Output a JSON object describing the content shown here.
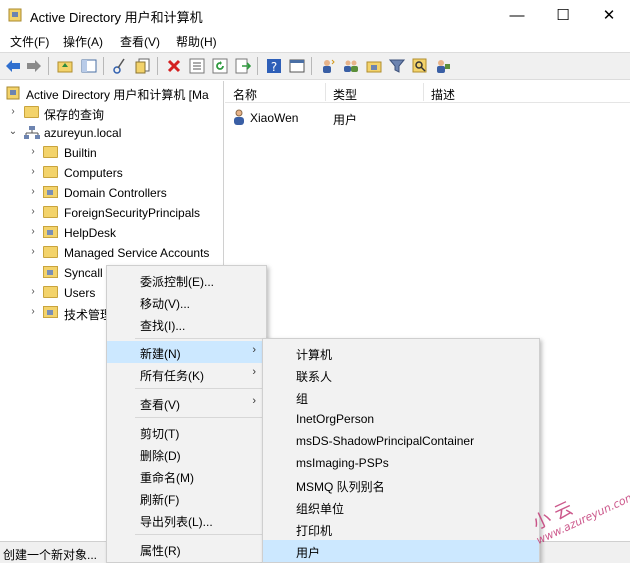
{
  "window": {
    "title": "Active Directory 用户和计算机",
    "minimize_glyph": "—",
    "maximize_glyph": "☐",
    "close_glyph": "✕"
  },
  "menubar": [
    "文件(F)",
    "操作(A)",
    "查看(V)",
    "帮助(H)"
  ],
  "toolbar_icons": [
    "back-arrow-icon",
    "forward-arrow-icon",
    "up-folder-icon",
    "show-tree-icon",
    "cut-icon",
    "copy-icon",
    "delete-icon",
    "properties-icon",
    "refresh-icon",
    "export-icon",
    "help-icon",
    "view-icon",
    "new-user-icon",
    "new-group-icon",
    "new-ou-icon",
    "filter-icon",
    "find-icon",
    "add-to-group-icon"
  ],
  "tree": {
    "root": "Active Directory 用户和计算机 [Ma",
    "saved_queries": "保存的查询",
    "domain": "azureyun.local",
    "children": [
      "Builtin",
      "Computers",
      "Domain Controllers",
      "ForeignSecurityPrincipals",
      "HelpDesk",
      "Managed Service Accounts",
      "Syncall",
      "Users",
      "技术管理"
    ]
  },
  "list": {
    "columns": [
      "名称",
      "类型",
      "描述"
    ],
    "rows": [
      {
        "name": "XiaoWen",
        "type": "用户",
        "desc": ""
      }
    ]
  },
  "context_menu": {
    "items": [
      "委派控制(E)...",
      "移动(V)...",
      "查找(I)...",
      "新建(N)",
      "所有任务(K)",
      "查看(V)",
      "剪切(T)",
      "删除(D)",
      "重命名(M)",
      "刷新(F)",
      "导出列表(L)...",
      "属性(R)"
    ]
  },
  "submenu": {
    "items": [
      "计算机",
      "联系人",
      "组",
      "InetOrgPerson",
      "msDS-ShadowPrincipalContainer",
      "msImaging-PSPs",
      "MSMQ 队列别名",
      "组织单位",
      "打印机",
      "用户"
    ]
  },
  "arrow_glyph": "›",
  "status": "创建一个新对象...",
  "watermark": {
    "line1": "小 云",
    "line2": "www.azureyun.com"
  },
  "colors": {
    "highlight": "#cce8ff",
    "menu_bg": "#f2f2f2",
    "folder": "#f3d36b"
  }
}
